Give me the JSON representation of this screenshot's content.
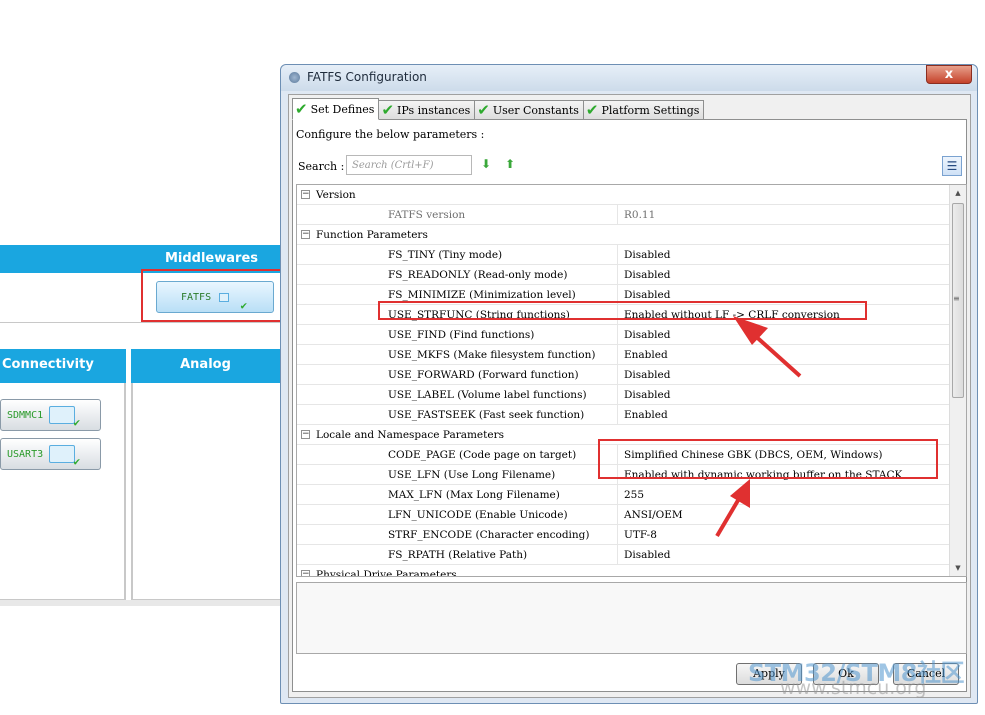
{
  "background": {
    "middlewares_header": "Middlewares",
    "connectivity_header": "Connectivity",
    "analog_header": "Analog",
    "ip_buttons": [
      "FATFS",
      "SDMMC1",
      "USART3"
    ]
  },
  "dialog": {
    "title": "FATFS Configuration",
    "close_label": "x",
    "tabs": [
      {
        "label": "Set Defines"
      },
      {
        "label": "IPs instances"
      },
      {
        "label": "User Constants"
      },
      {
        "label": "Platform Settings"
      }
    ],
    "configure_label": "Configure the below parameters :",
    "search_label": "Search :",
    "search_placeholder": "Search (Crtl+F)",
    "sections": {
      "version": {
        "title": "Version",
        "rows": [
          {
            "name": "FATFS version",
            "value": "R0.11"
          }
        ]
      },
      "function": {
        "title": "Function Parameters",
        "rows": [
          {
            "name": "FS_TINY (Tiny mode)",
            "value": "Disabled"
          },
          {
            "name": "FS_READONLY (Read-only mode)",
            "value": "Disabled"
          },
          {
            "name": "FS_MINIMIZE (Minimization level)",
            "value": "Disabled"
          },
          {
            "name": "USE_STRFUNC (String functions)",
            "value": "Enabled without LF -> CRLF conversion"
          },
          {
            "name": "USE_FIND (Find functions)",
            "value": "Disabled"
          },
          {
            "name": "USE_MKFS (Make filesystem function)",
            "value": "Enabled"
          },
          {
            "name": "USE_FORWARD (Forward function)",
            "value": "Disabled"
          },
          {
            "name": "USE_LABEL (Volume label functions)",
            "value": "Disabled"
          },
          {
            "name": "USE_FASTSEEK (Fast seek function)",
            "value": "Enabled"
          }
        ]
      },
      "locale": {
        "title": "Locale and Namespace Parameters",
        "rows": [
          {
            "name": "CODE_PAGE (Code page on target)",
            "value": "Simplified Chinese GBK (DBCS, OEM, Windows)"
          },
          {
            "name": "USE_LFN (Use Long Filename)",
            "value": "Enabled with dynamic working buffer on the STACK"
          },
          {
            "name": "MAX_LFN (Max Long Filename)",
            "value": "255"
          },
          {
            "name": "LFN_UNICODE (Enable Unicode)",
            "value": "ANSI/OEM"
          },
          {
            "name": "STRF_ENCODE (Character encoding)",
            "value": "UTF-8"
          },
          {
            "name": "FS_RPATH (Relative Path)",
            "value": "Disabled"
          }
        ]
      },
      "physical": {
        "title": "Physical Drive Parameters"
      }
    },
    "buttons": {
      "apply": "Apply",
      "ok": "Ok",
      "cancel": "Cancel"
    }
  },
  "watermark": {
    "main": "STM32/STM8社区",
    "url": "www.stmcu.org"
  },
  "colors": {
    "accent": "#1aa6e0",
    "annotation": "#e03030",
    "check": "#2eaa2e"
  }
}
